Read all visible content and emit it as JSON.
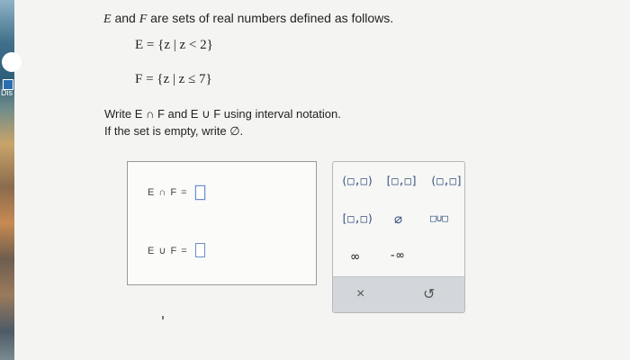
{
  "background_window": {
    "label": "Dis"
  },
  "problem": {
    "intro_e": "E",
    "intro_mid": " and ",
    "intro_f": "F",
    "intro_rest": " are sets of real numbers defined as follows.",
    "set_e": "E = {z | z < 2}",
    "set_f": "F = {z | z ≤ 7}",
    "instruction": "Write E ∩ F and E ∪ F using interval notation.",
    "empty_note": "If the set is empty, write ∅."
  },
  "answers": {
    "intersection_label": "E ∩ F =",
    "union_label": "E ∪ F =",
    "intersection_value": "",
    "union_value": ""
  },
  "keypad": {
    "open_open": "(□,□)",
    "closed_closed": "[□,□]",
    "open_closed": "(□,□]",
    "closed_open": "[□,□)",
    "empty_set": "∅",
    "union": "□∪□",
    "infinity": "∞",
    "neg_infinity": "-∞",
    "clear": "×",
    "reset": "↺"
  }
}
